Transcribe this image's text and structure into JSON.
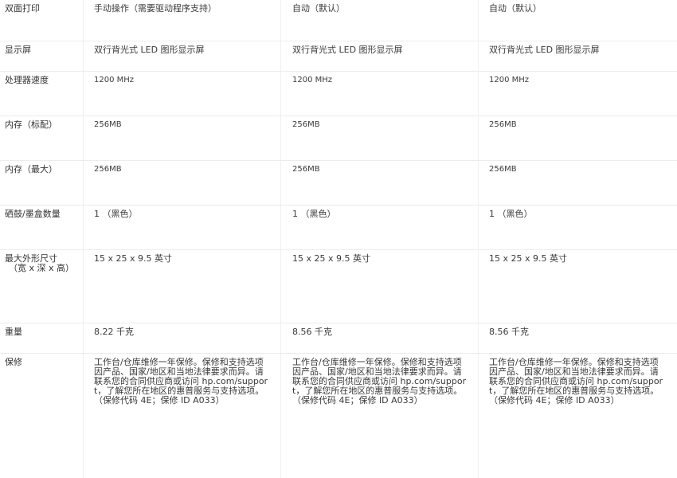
{
  "rows": [
    {
      "label": "双面打印",
      "values": [
        "手动操作（需要驱动程序支持）",
        "自动（默认）",
        "自动（默认）"
      ]
    },
    {
      "label": "显示屏",
      "values": [
        "双行背光式 LED 图形显示屏",
        "双行背光式 LED 图形显示屏",
        "双行背光式 LED 图形显示屏"
      ]
    },
    {
      "label": "处理器速度",
      "values": [
        "1200 MHz",
        "1200 MHz",
        "1200 MHz"
      ]
    },
    {
      "label": "内存（标配）",
      "values": [
        "256MB",
        "256MB",
        "256MB"
      ]
    },
    {
      "label": "内存（最大）",
      "values": [
        "256MB",
        "256MB",
        "256MB"
      ]
    },
    {
      "label": "硒鼓/墨盒数量",
      "values": [
        "1 （黑色）",
        "1 （黑色）",
        "1 （黑色）"
      ]
    },
    {
      "label": "最大外形尺寸",
      "label_sub": "（宽 x 深 x 高）",
      "values": [
        "15 x 25 x 9.5 英寸",
        "15 x 25 x 9.5 英寸",
        "15 x 25 x 9.5 英寸"
      ]
    },
    {
      "label": "重量",
      "values": [
        "8.22 千克",
        "8.56 千克",
        "8.56 千克"
      ]
    },
    {
      "label": "保修",
      "values": [
        "工作台/仓库维修一年保修。保修和支持选项因产品、国家/地区和当地法律要求而异。请联系您的合同供应商或访问 hp.com/support，了解您所在地区的惠普服务与支持选项。（保修代码 4E；保修 ID A033）",
        "工作台/仓库维修一年保修。保修和支持选项因产品、国家/地区和当地法律要求而异。请联系您的合同供应商或访问 hp.com/support，了解您所在地区的惠普服务与支持选项。（保修代码 4E；保修 ID A033）",
        "工作台/仓库维修一年保修。保修和支持选项因产品、国家/地区和当地法律要求而异。请联系您的合同供应商或访问 hp.com/support，了解您所在地区的惠普服务与支持选项。（保修代码 4E；保修 ID A033）"
      ]
    }
  ]
}
